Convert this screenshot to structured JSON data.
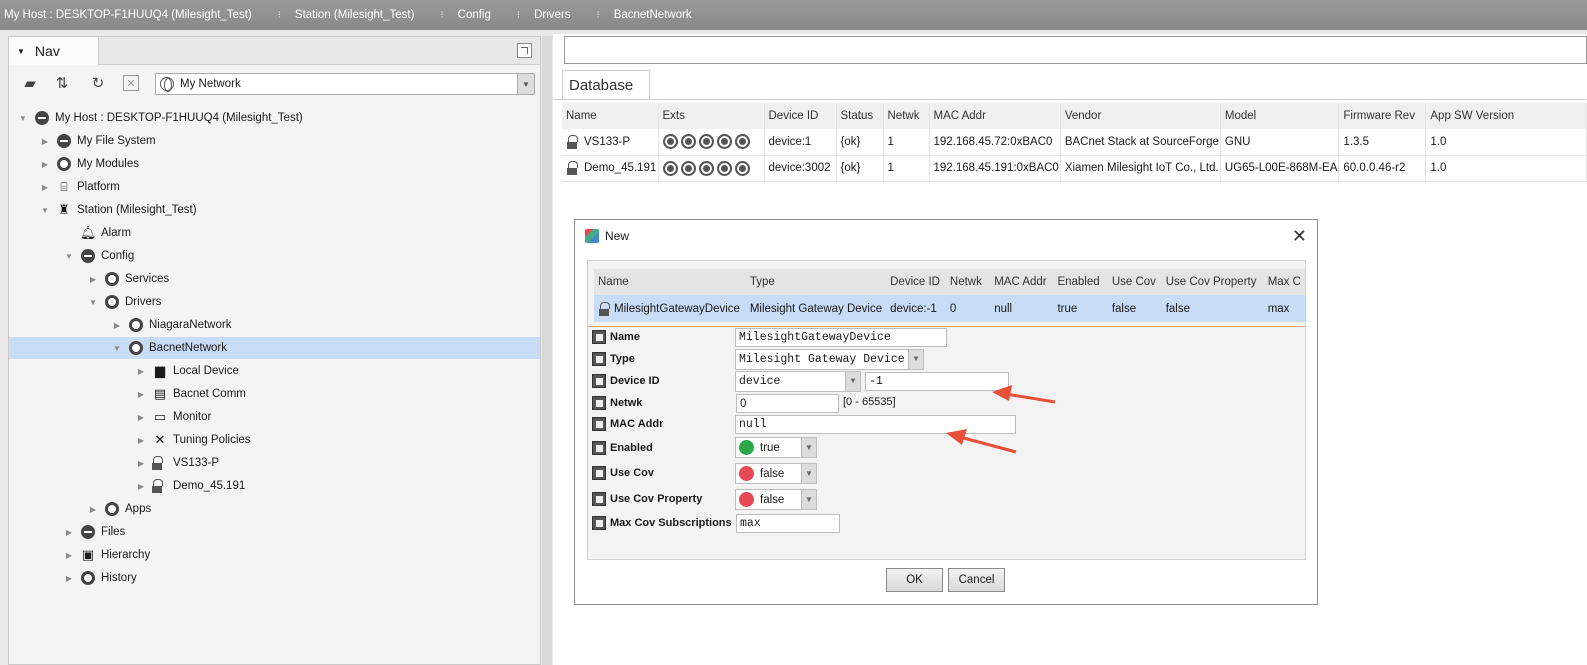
{
  "pathbar": {
    "crumbs": [
      "My Host : DESKTOP-F1HUUQ4 (Milesight_Test)",
      "Station (Milesight_Test)",
      "Config",
      "Drivers",
      "BacnetNetwork"
    ]
  },
  "nav": {
    "tab_label": "Nav",
    "combo_value": "My Network",
    "tree": [
      {
        "label": "My Host : DESKTOP-F1HUUQ4 (Milesight_Test)"
      },
      {
        "label": "My File System"
      },
      {
        "label": "My Modules"
      },
      {
        "label": "Platform"
      },
      {
        "label": "Station (Milesight_Test)"
      },
      {
        "label": "Alarm"
      },
      {
        "label": "Config"
      },
      {
        "label": "Services"
      },
      {
        "label": "Drivers"
      },
      {
        "label": "NiagaraNetwork"
      },
      {
        "label": "BacnetNetwork"
      },
      {
        "label": "Local Device"
      },
      {
        "label": "Bacnet Comm"
      },
      {
        "label": "Monitor"
      },
      {
        "label": "Tuning Policies"
      },
      {
        "label": "VS133-P"
      },
      {
        "label": "Demo_45.191"
      },
      {
        "label": "Apps"
      },
      {
        "label": "Files"
      },
      {
        "label": "Hierarchy"
      },
      {
        "label": "History"
      }
    ]
  },
  "database": {
    "tab_label": "Database",
    "columns": [
      "Name",
      "Exts",
      "Device ID",
      "Status",
      "Netwk",
      "MAC Addr",
      "Vendor",
      "Model",
      "Firmware Rev",
      "App SW Version"
    ],
    "rows": [
      {
        "name": "VS133-P",
        "device_id": "device:1",
        "status": "{ok}",
        "netwk": "1",
        "mac": "192.168.45.72:0xBAC0",
        "vendor": "BACnet Stack at SourceForge",
        "model": "GNU",
        "firmware": "1.3.5",
        "appsw": "1.0"
      },
      {
        "name": "Demo_45.191",
        "device_id": "device:3002",
        "status": "{ok}",
        "netwk": "1",
        "mac": "192.168.45.191:0xBAC0",
        "vendor": "Xiamen Milesight IoT Co., Ltd.",
        "model": "UG65-L00E-868M-EA",
        "firmware": "60.0.0.46-r2",
        "appsw": "1.0"
      }
    ]
  },
  "dialog": {
    "title": "New",
    "close": "✕",
    "columns": [
      "Name",
      "Type",
      "Device ID",
      "Netwk",
      "MAC Addr",
      "Enabled",
      "Use Cov",
      "Use Cov Property",
      "Max C"
    ],
    "row": {
      "name": "MilesightGatewayDevice",
      "type": "Milesight Gateway Device",
      "device_id": "device:-1",
      "netwk": "0",
      "mac": "null",
      "enabled": "true",
      "use_cov": "false",
      "use_cov_prop": "false",
      "max": "max"
    },
    "props": {
      "name_label": "Name",
      "name_value": "MilesightGatewayDevice",
      "type_label": "Type",
      "type_value": "Milesight Gateway Device",
      "devid_label": "Device ID",
      "devid_type": "device",
      "devid_value": "-1",
      "netwk_label": "Netwk",
      "netwk_value": "0",
      "netwk_range": "[0 - 65535]",
      "mac_label": "MAC Addr",
      "mac_value": "null",
      "enabled_label": "Enabled",
      "enabled_value": "true",
      "usecov_label": "Use Cov",
      "usecov_value": "false",
      "usecovprop_label": "Use Cov Property",
      "usecovprop_value": "false",
      "maxcov_label": "Max Cov Subscriptions",
      "maxcov_value": "max"
    },
    "ok_label": "OK",
    "cancel_label": "Cancel"
  },
  "colors": {
    "true_dot": "#2aa84a",
    "false_dot": "#e84a55",
    "selection": "#c8dcf6",
    "arrow": "#e8503a"
  }
}
